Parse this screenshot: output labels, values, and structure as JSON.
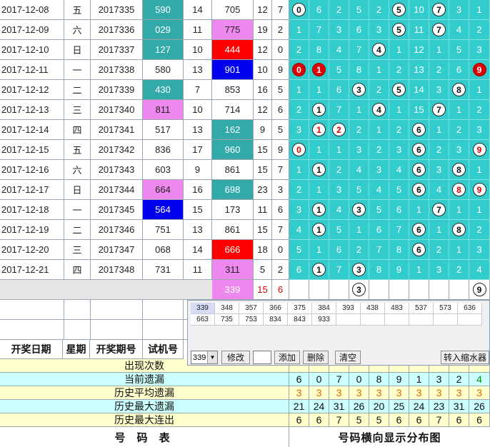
{
  "rows": [
    {
      "date": "2017-12-08",
      "weekday": "五",
      "period": "2017335",
      "trial": "590",
      "span": "14",
      "draw": "705",
      "sum": "12",
      "tail": "7",
      "trial_hl": "teal",
      "draw_hl": "",
      "dist": [
        {
          "t": "ball",
          "v": "0"
        },
        {
          "t": "n",
          "v": "6"
        },
        {
          "t": "n",
          "v": "2"
        },
        {
          "t": "n",
          "v": "5"
        },
        {
          "t": "n",
          "v": "2"
        },
        {
          "t": "ball",
          "v": "5"
        },
        {
          "t": "n",
          "v": "10"
        },
        {
          "t": "ball",
          "v": "7"
        },
        {
          "t": "n",
          "v": "3"
        },
        {
          "t": "n",
          "v": "1"
        }
      ]
    },
    {
      "date": "2017-12-09",
      "weekday": "六",
      "period": "2017336",
      "trial": "029",
      "span": "11",
      "draw": "775",
      "sum": "19",
      "tail": "2",
      "trial_hl": "teal",
      "draw_hl": "pink",
      "dist": [
        {
          "t": "n",
          "v": "1"
        },
        {
          "t": "n",
          "v": "7"
        },
        {
          "t": "n",
          "v": "3"
        },
        {
          "t": "n",
          "v": "6"
        },
        {
          "t": "n",
          "v": "3"
        },
        {
          "t": "ball",
          "v": "5"
        },
        {
          "t": "n",
          "v": "11"
        },
        {
          "t": "ball",
          "v": "7"
        },
        {
          "t": "n",
          "v": "4"
        },
        {
          "t": "n",
          "v": "2"
        }
      ]
    },
    {
      "date": "2017-12-10",
      "weekday": "日",
      "period": "2017337",
      "trial": "127",
      "span": "10",
      "draw": "444",
      "sum": "12",
      "tail": "0",
      "trial_hl": "teal",
      "draw_hl": "red",
      "dist": [
        {
          "t": "n",
          "v": "2"
        },
        {
          "t": "n",
          "v": "8"
        },
        {
          "t": "n",
          "v": "4"
        },
        {
          "t": "n",
          "v": "7"
        },
        {
          "t": "ball",
          "v": "4"
        },
        {
          "t": "n",
          "v": "1"
        },
        {
          "t": "n",
          "v": "12"
        },
        {
          "t": "n",
          "v": "1"
        },
        {
          "t": "n",
          "v": "5"
        },
        {
          "t": "n",
          "v": "3"
        }
      ]
    },
    {
      "date": "2017-12-11",
      "weekday": "一",
      "period": "2017338",
      "trial": "580",
      "span": "13",
      "draw": "901",
      "sum": "10",
      "tail": "9",
      "trial_hl": "",
      "draw_hl": "blue",
      "dist": [
        {
          "t": "red",
          "v": "0"
        },
        {
          "t": "red",
          "v": "1"
        },
        {
          "t": "n",
          "v": "5"
        },
        {
          "t": "n",
          "v": "8"
        },
        {
          "t": "n",
          "v": "1"
        },
        {
          "t": "n",
          "v": "2"
        },
        {
          "t": "n",
          "v": "13"
        },
        {
          "t": "n",
          "v": "2"
        },
        {
          "t": "n",
          "v": "6"
        },
        {
          "t": "red",
          "v": "9"
        }
      ]
    },
    {
      "date": "2017-12-12",
      "weekday": "二",
      "period": "2017339",
      "trial": "430",
      "span": "7",
      "draw": "853",
      "sum": "16",
      "tail": "5",
      "trial_hl": "teal",
      "draw_hl": "",
      "dist": [
        {
          "t": "n",
          "v": "1"
        },
        {
          "t": "n",
          "v": "1"
        },
        {
          "t": "n",
          "v": "6"
        },
        {
          "t": "ball",
          "v": "3"
        },
        {
          "t": "n",
          "v": "2"
        },
        {
          "t": "ball",
          "v": "5"
        },
        {
          "t": "n",
          "v": "14"
        },
        {
          "t": "n",
          "v": "3"
        },
        {
          "t": "ball",
          "v": "8"
        },
        {
          "t": "n",
          "v": "1"
        }
      ]
    },
    {
      "date": "2017-12-13",
      "weekday": "三",
      "period": "2017340",
      "trial": "811",
      "span": "10",
      "draw": "714",
      "sum": "12",
      "tail": "6",
      "trial_hl": "pink",
      "draw_hl": "",
      "dist": [
        {
          "t": "n",
          "v": "2"
        },
        {
          "t": "ball",
          "v": "1"
        },
        {
          "t": "n",
          "v": "7"
        },
        {
          "t": "n",
          "v": "1"
        },
        {
          "t": "ball",
          "v": "4"
        },
        {
          "t": "n",
          "v": "1"
        },
        {
          "t": "n",
          "v": "15"
        },
        {
          "t": "ball",
          "v": "7"
        },
        {
          "t": "n",
          "v": "1"
        },
        {
          "t": "n",
          "v": "2"
        }
      ]
    },
    {
      "date": "2017-12-14",
      "weekday": "四",
      "period": "2017341",
      "trial": "517",
      "span": "13",
      "draw": "162",
      "sum": "9",
      "tail": "5",
      "trial_hl": "",
      "draw_hl": "teal",
      "dist": [
        {
          "t": "n",
          "v": "3"
        },
        {
          "t": "redtext",
          "v": "1"
        },
        {
          "t": "redtext",
          "v": "2"
        },
        {
          "t": "n",
          "v": "2"
        },
        {
          "t": "n",
          "v": "1"
        },
        {
          "t": "n",
          "v": "2"
        },
        {
          "t": "ball",
          "v": "6"
        },
        {
          "t": "n",
          "v": "1"
        },
        {
          "t": "n",
          "v": "2"
        },
        {
          "t": "n",
          "v": "3"
        }
      ]
    },
    {
      "date": "2017-12-15",
      "weekday": "五",
      "period": "2017342",
      "trial": "836",
      "span": "17",
      "draw": "960",
      "sum": "15",
      "tail": "9",
      "trial_hl": "",
      "draw_hl": "teal",
      "dist": [
        {
          "t": "redtext",
          "v": "0"
        },
        {
          "t": "n",
          "v": "1"
        },
        {
          "t": "n",
          "v": "1"
        },
        {
          "t": "n",
          "v": "3"
        },
        {
          "t": "n",
          "v": "2"
        },
        {
          "t": "n",
          "v": "3"
        },
        {
          "t": "ball",
          "v": "6"
        },
        {
          "t": "n",
          "v": "2"
        },
        {
          "t": "n",
          "v": "3"
        },
        {
          "t": "redtext",
          "v": "9"
        }
      ]
    },
    {
      "date": "2017-12-16",
      "weekday": "六",
      "period": "2017343",
      "trial": "603",
      "span": "9",
      "draw": "861",
      "sum": "15",
      "tail": "7",
      "trial_hl": "",
      "draw_hl": "",
      "dist": [
        {
          "t": "n",
          "v": "1"
        },
        {
          "t": "ball",
          "v": "1"
        },
        {
          "t": "n",
          "v": "2"
        },
        {
          "t": "n",
          "v": "4"
        },
        {
          "t": "n",
          "v": "3"
        },
        {
          "t": "n",
          "v": "4"
        },
        {
          "t": "ball",
          "v": "6"
        },
        {
          "t": "n",
          "v": "3"
        },
        {
          "t": "ball",
          "v": "8"
        },
        {
          "t": "n",
          "v": "1"
        }
      ]
    },
    {
      "date": "2017-12-17",
      "weekday": "日",
      "period": "2017344",
      "trial": "664",
      "span": "16",
      "draw": "698",
      "sum": "23",
      "tail": "3",
      "trial_hl": "pink",
      "draw_hl": "teal",
      "dist": [
        {
          "t": "n",
          "v": "2"
        },
        {
          "t": "n",
          "v": "1"
        },
        {
          "t": "n",
          "v": "3"
        },
        {
          "t": "n",
          "v": "5"
        },
        {
          "t": "n",
          "v": "4"
        },
        {
          "t": "n",
          "v": "5"
        },
        {
          "t": "ball",
          "v": "6"
        },
        {
          "t": "n",
          "v": "4"
        },
        {
          "t": "redtext",
          "v": "8"
        },
        {
          "t": "redtext",
          "v": "9"
        }
      ]
    },
    {
      "date": "2017-12-18",
      "weekday": "一",
      "period": "2017345",
      "trial": "564",
      "span": "15",
      "draw": "173",
      "sum": "11",
      "tail": "6",
      "trial_hl": "blue",
      "draw_hl": "",
      "dist": [
        {
          "t": "n",
          "v": "3"
        },
        {
          "t": "ball",
          "v": "1"
        },
        {
          "t": "n",
          "v": "4"
        },
        {
          "t": "ball",
          "v": "3"
        },
        {
          "t": "n",
          "v": "5"
        },
        {
          "t": "n",
          "v": "6"
        },
        {
          "t": "n",
          "v": "1"
        },
        {
          "t": "ball",
          "v": "7"
        },
        {
          "t": "n",
          "v": "1"
        },
        {
          "t": "n",
          "v": "1"
        }
      ]
    },
    {
      "date": "2017-12-19",
      "weekday": "二",
      "period": "2017346",
      "trial": "751",
      "span": "13",
      "draw": "861",
      "sum": "15",
      "tail": "7",
      "trial_hl": "",
      "draw_hl": "",
      "dist": [
        {
          "t": "n",
          "v": "4"
        },
        {
          "t": "ball",
          "v": "1"
        },
        {
          "t": "n",
          "v": "5"
        },
        {
          "t": "n",
          "v": "1"
        },
        {
          "t": "n",
          "v": "6"
        },
        {
          "t": "n",
          "v": "7"
        },
        {
          "t": "ball",
          "v": "6"
        },
        {
          "t": "n",
          "v": "1"
        },
        {
          "t": "ball",
          "v": "8"
        },
        {
          "t": "n",
          "v": "2"
        }
      ]
    },
    {
      "date": "2017-12-20",
      "weekday": "三",
      "period": "2017347",
      "trial": "068",
      "span": "14",
      "draw": "666",
      "sum": "18",
      "tail": "0",
      "trial_hl": "",
      "draw_hl": "red",
      "dist": [
        {
          "t": "n",
          "v": "5"
        },
        {
          "t": "n",
          "v": "1"
        },
        {
          "t": "n",
          "v": "6"
        },
        {
          "t": "n",
          "v": "2"
        },
        {
          "t": "n",
          "v": "7"
        },
        {
          "t": "n",
          "v": "8"
        },
        {
          "t": "ball",
          "v": "6"
        },
        {
          "t": "n",
          "v": "2"
        },
        {
          "t": "n",
          "v": "1"
        },
        {
          "t": "n",
          "v": "3"
        }
      ]
    },
    {
      "date": "2017-12-21",
      "weekday": "四",
      "period": "2017348",
      "trial": "731",
      "span": "11",
      "draw": "311",
      "sum": "5",
      "tail": "2",
      "trial_hl": "",
      "draw_hl": "pink",
      "dist": [
        {
          "t": "n",
          "v": "6"
        },
        {
          "t": "ball",
          "v": "1"
        },
        {
          "t": "n",
          "v": "7"
        },
        {
          "t": "ball",
          "v": "3"
        },
        {
          "t": "n",
          "v": "8"
        },
        {
          "t": "n",
          "v": "9"
        },
        {
          "t": "n",
          "v": "1"
        },
        {
          "t": "n",
          "v": "3"
        },
        {
          "t": "n",
          "v": "2"
        },
        {
          "t": "n",
          "v": "4"
        }
      ]
    }
  ],
  "next_row": {
    "draw": "339",
    "sum": "15",
    "tail": "6",
    "dist": [
      {
        "t": "e",
        "v": ""
      },
      {
        "t": "e",
        "v": ""
      },
      {
        "t": "e",
        "v": ""
      },
      {
        "t": "ball",
        "v": "3"
      },
      {
        "t": "e",
        "v": ""
      },
      {
        "t": "e",
        "v": ""
      },
      {
        "t": "e",
        "v": ""
      },
      {
        "t": "e",
        "v": ""
      },
      {
        "t": "e",
        "v": ""
      },
      {
        "t": "ball",
        "v": "9"
      }
    ]
  },
  "header": {
    "date": "开奖日期",
    "weekday": "星期",
    "period": "开奖期号",
    "trial": "试机号"
  },
  "stats": [
    {
      "label": "出现次数",
      "values": [],
      "bg": "#ffffcc"
    },
    {
      "label": "当前遗漏",
      "values": [
        "6",
        "0",
        "7",
        "0",
        "8",
        "9",
        "1",
        "3",
        "2",
        "4"
      ],
      "bg": "#ccffff",
      "last_color": "#009900"
    },
    {
      "label": "历史平均遗漏",
      "values": [
        "3",
        "3",
        "3",
        "3",
        "3",
        "3",
        "3",
        "3",
        "3",
        "3"
      ],
      "bg": "#ffffcc",
      "num_color": "#dd6600"
    },
    {
      "label": "历史最大遗漏",
      "values": [
        "21",
        "24",
        "31",
        "26",
        "20",
        "25",
        "24",
        "23",
        "31",
        "26"
      ],
      "bg": "#ccffff"
    },
    {
      "label": "历史最大连出",
      "values": [
        "6",
        "6",
        "7",
        "5",
        "5",
        "6",
        "6",
        "7",
        "6",
        "6"
      ],
      "bg": "#ffffcc"
    }
  ],
  "footer": {
    "left": "号 码 表",
    "right": "号码横向显示分布图"
  },
  "panel": {
    "table": [
      [
        "339",
        "348",
        "357",
        "366",
        "375",
        "384",
        "393",
        "438",
        "483",
        "537",
        "573",
        "636"
      ],
      [
        "663",
        "735",
        "753",
        "834",
        "843",
        "933",
        "",
        "",
        "",
        "",
        "",
        ""
      ]
    ],
    "select_value": "339",
    "buttons": {
      "edit": "修改",
      "add": "添加",
      "delete": "删除",
      "clear": "清空",
      "shrink": "转入缩水器"
    },
    "input_value": ""
  },
  "colors": {
    "teal": "#33aaaa",
    "pink": "#ee88ee",
    "red": "#ff0000",
    "blue": "#0000ee",
    "dist": "#33cccc"
  }
}
